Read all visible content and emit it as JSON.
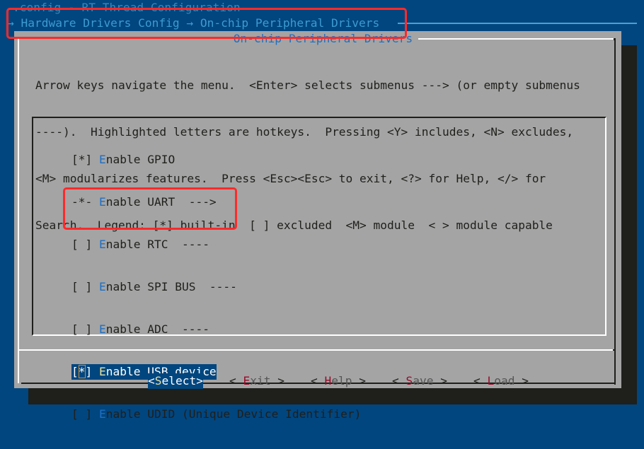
{
  "window": {
    "title": ".config - RT Thread Configuration",
    "breadcrumb": [
      {
        "icon": "arrow-right-icon",
        "glyph": "→",
        "label": "Hardware Drivers Config"
      },
      {
        "icon": "arrow-right-icon",
        "glyph": "→",
        "label": "On-chip Peripheral Drivers"
      }
    ],
    "breadcrumb_text": "→ Hardware Drivers Config → On-chip Peripheral Drivers"
  },
  "dialog": {
    "title": " On-chip Peripheral Drivers ",
    "help_lines": [
      "Arrow keys navigate the menu.  <Enter> selects submenus ---> (or empty submenus",
      "----).  Highlighted letters are hotkeys.  Pressing <Y> includes, <N> excludes,",
      "<M> modularizes features.  Press <Esc><Esc> to exit, <?> for Help, </> for",
      "Search.  Legend: [*] built-in  [ ] excluded  <M> module  < > module capable"
    ]
  },
  "menu": {
    "items": [
      {
        "state": "[*]",
        "hotkey": "E",
        "rest": "nable GPIO",
        "selected": false
      },
      {
        "state": "-*-",
        "hotkey": "E",
        "rest": "nable UART  --->",
        "selected": false
      },
      {
        "state": "[ ]",
        "hotkey": "E",
        "rest": "nable RTC  ----",
        "selected": false
      },
      {
        "state": "[ ]",
        "hotkey": "E",
        "rest": "nable SPI BUS  ----",
        "selected": false
      },
      {
        "state": "[ ]",
        "hotkey": "E",
        "rest": "nable ADC  ----",
        "selected": false
      },
      {
        "state_open": "[",
        "state_mark": "*",
        "state_close": "]",
        "state": "[*]",
        "hotkey": "E",
        "rest": "nable USB device",
        "selected": true
      },
      {
        "state": "[ ]",
        "hotkey": "E",
        "rest": "nable UDID (Unique Device Identifier)",
        "selected": false
      }
    ]
  },
  "buttons": [
    {
      "open": "<",
      "hotkey": "S",
      "rest": "elect",
      "close": ">",
      "active": true
    },
    {
      "open": "< ",
      "hotkey": "E",
      "rest": "xit",
      "close": " >",
      "active": false
    },
    {
      "open": "< ",
      "hotkey": "H",
      "rest": "elp",
      "close": " >",
      "active": false
    },
    {
      "open": "< ",
      "hotkey": "S",
      "rest": "ave",
      "close": " >",
      "active": false
    },
    {
      "open": "< ",
      "hotkey": "L",
      "rest": "oad",
      "close": " >",
      "active": false
    }
  ],
  "colors": {
    "background": "#01467f",
    "dialog": "#a4a4a4",
    "shadow": "#1f1f1b",
    "highlight": "#01467f",
    "hotkey_menu": "#1e6fc3",
    "hotkey_button": "#9a0a2a",
    "annotation": "#ff2a2a"
  }
}
